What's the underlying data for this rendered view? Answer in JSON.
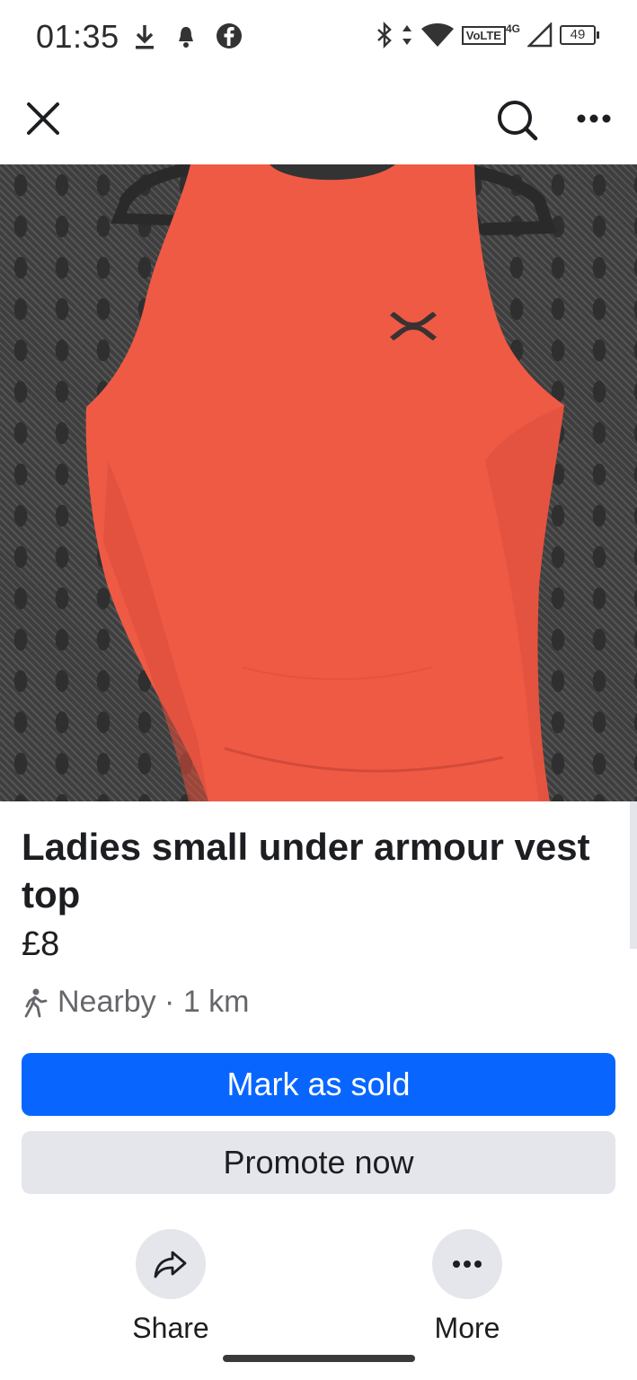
{
  "status_bar": {
    "time": "01:35",
    "network_badge": "VoLTE",
    "network_type": "4G",
    "battery": "49"
  },
  "listing": {
    "title": "Ladies small under armour vest top",
    "price": "£8",
    "location": "Nearby · 1 km"
  },
  "buttons": {
    "mark_as_sold": "Mark as sold",
    "promote_now": "Promote now"
  },
  "actions": {
    "share": "Share",
    "more": "More"
  },
  "colors": {
    "primary": "#0866ff",
    "secondary_bg": "#e4e6eb",
    "garment": "#ef5a45"
  },
  "icons": [
    "download-icon",
    "notification-icon",
    "facebook-icon",
    "bluetooth-icon",
    "data-arrows-icon",
    "wifi-icon",
    "signal-icon",
    "battery-icon",
    "close-icon",
    "search-icon",
    "more-horizontal-icon",
    "walking-person-icon",
    "share-icon"
  ]
}
